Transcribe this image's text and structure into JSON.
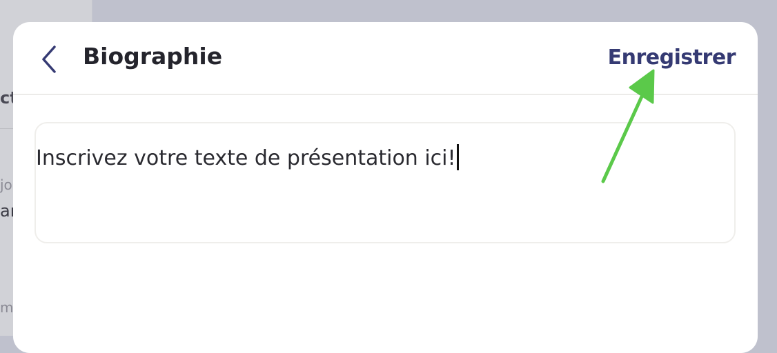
{
  "background": {
    "fragments": [
      "ct",
      "jo",
      "ar",
      "m"
    ]
  },
  "modal": {
    "back_icon": "chevron-left-icon",
    "title": "Biographie",
    "save_label": "Enregistrer",
    "bio_text": "Inscrivez votre texte de présentation ici!"
  },
  "annotation": {
    "arrow_color": "#5bc94a",
    "arrow_icon": "arrow-pointer-icon"
  },
  "colors": {
    "accent": "#353a73",
    "overlay": "#bfc1cd"
  }
}
